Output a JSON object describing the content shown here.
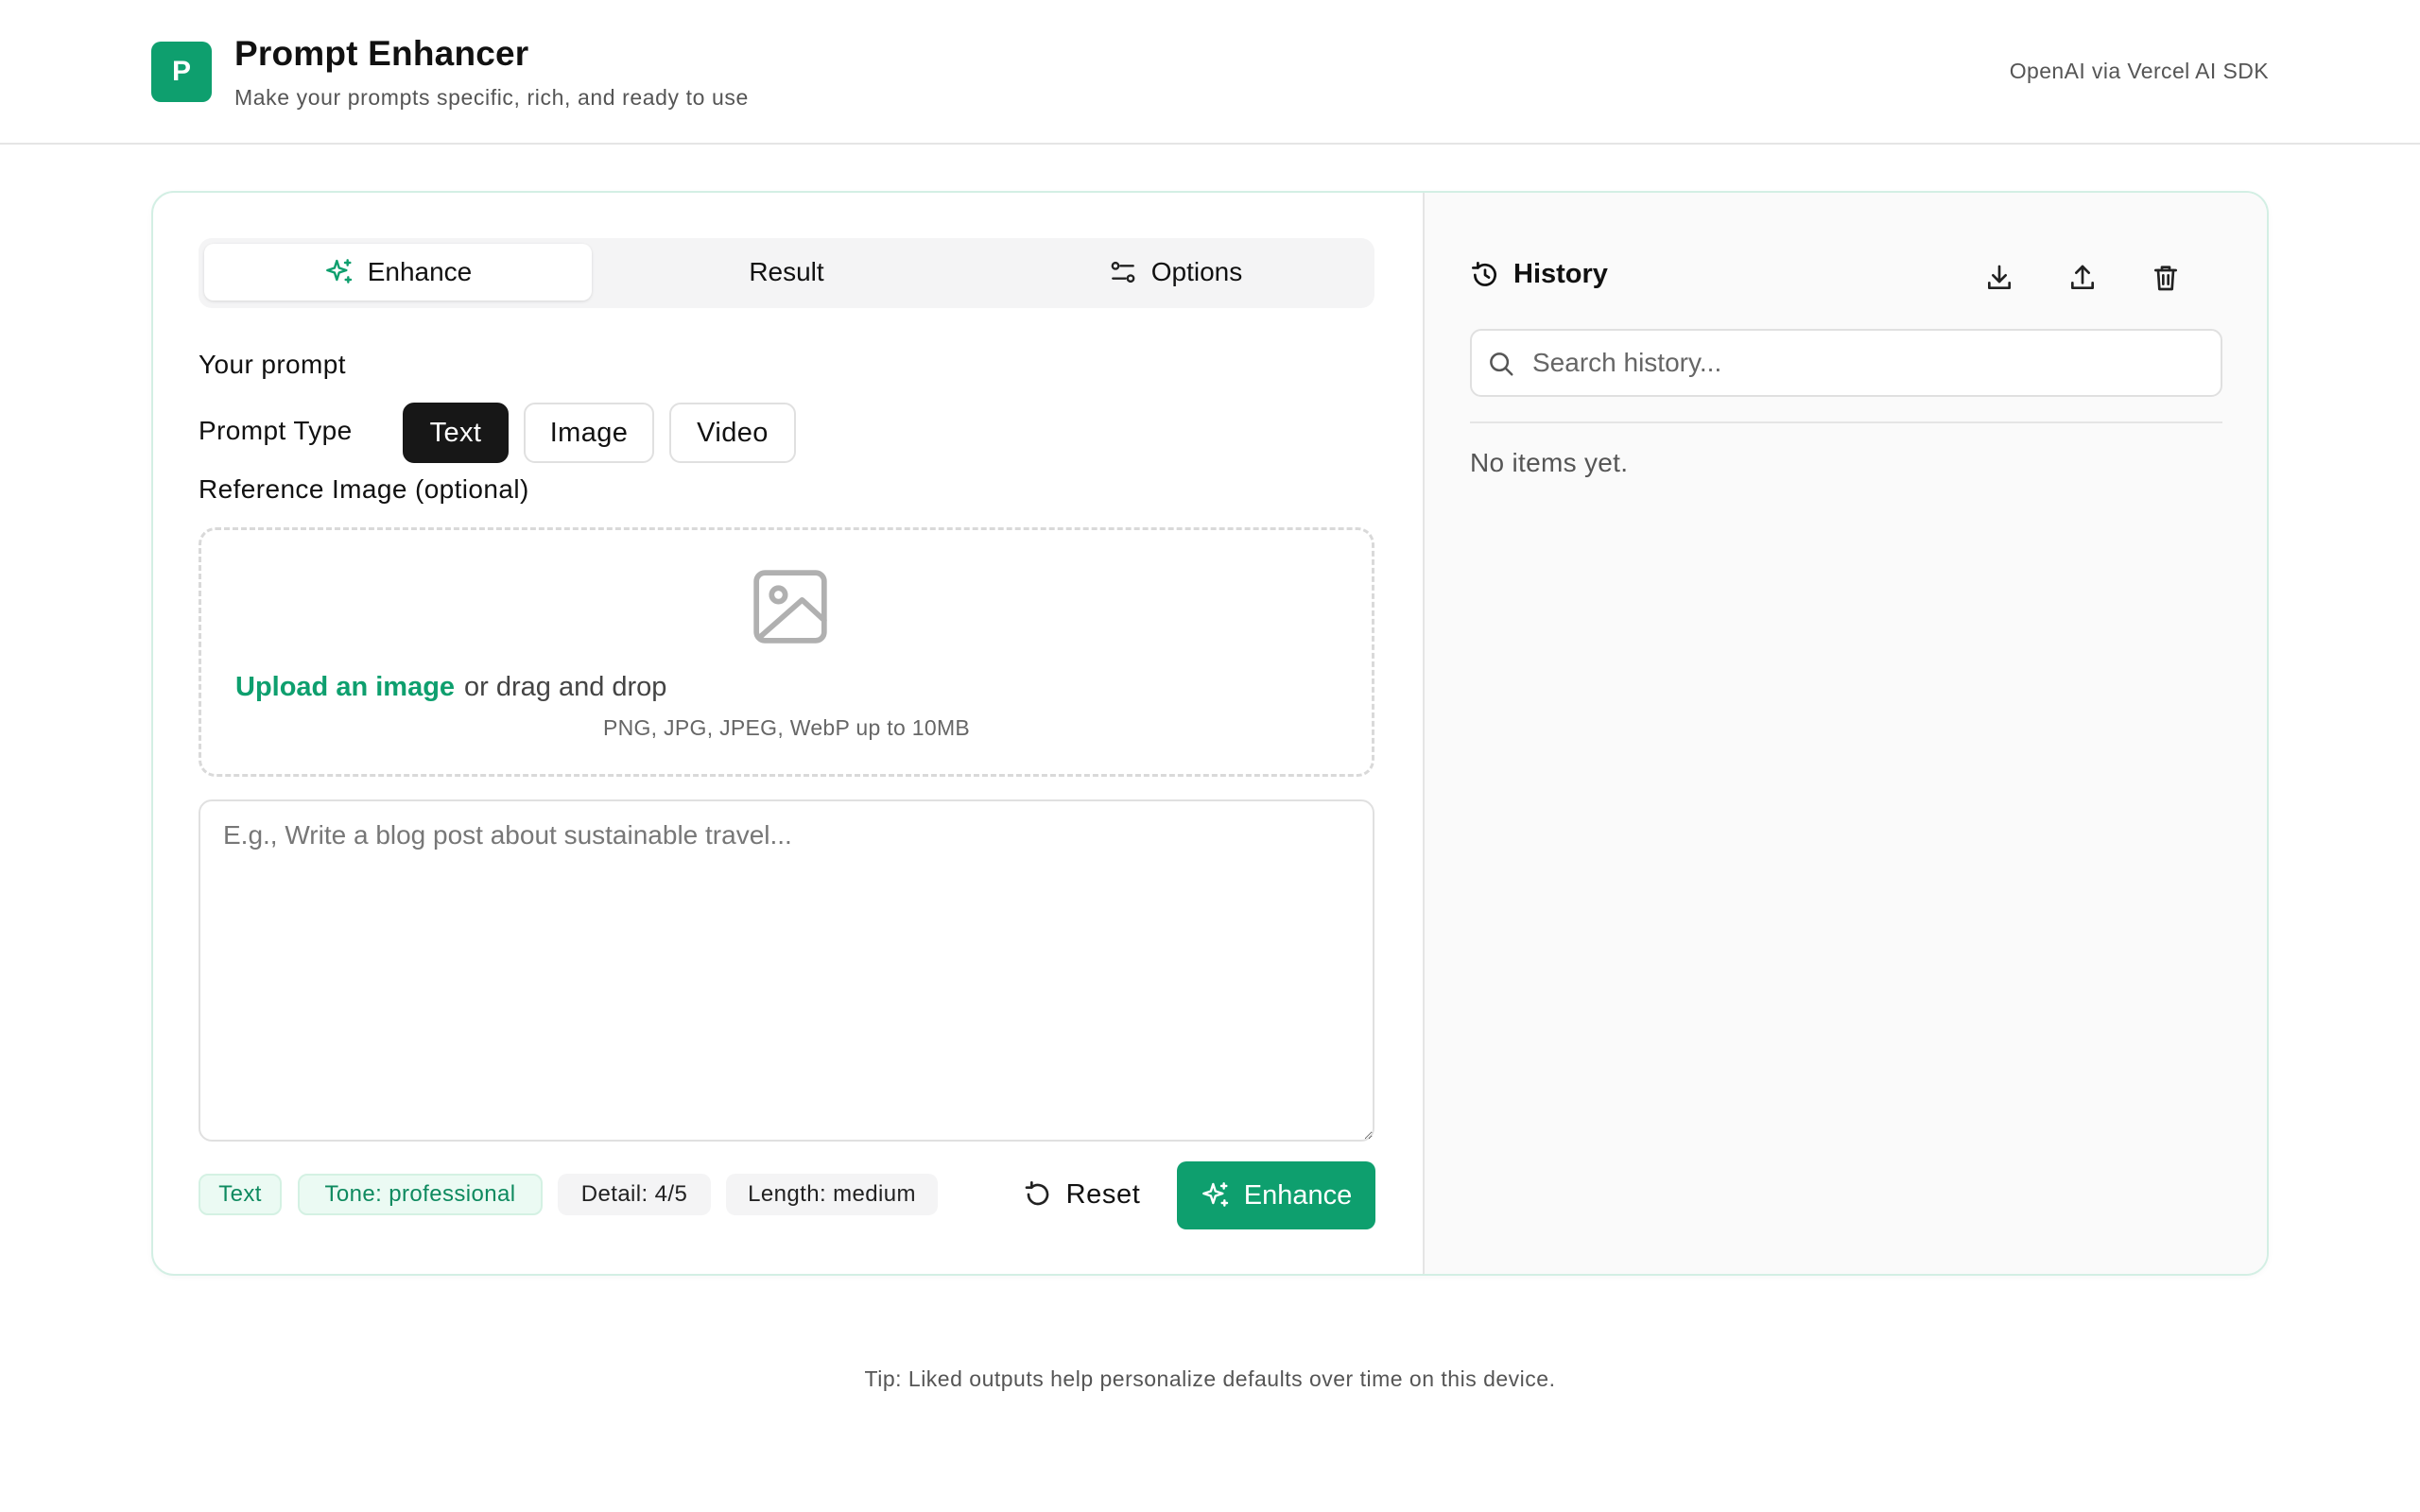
{
  "header": {
    "logo_letter": "P",
    "title": "Prompt Enhancer",
    "subtitle": "Make your prompts specific, rich, and ready to use",
    "provider": "OpenAI via Vercel AI SDK"
  },
  "tabs": [
    {
      "label": "Enhance",
      "icon": "sparkles-icon",
      "active": true
    },
    {
      "label": "Result",
      "active": false
    },
    {
      "label": "Options",
      "icon": "sliders-icon",
      "active": false
    }
  ],
  "form": {
    "section_label": "Your prompt",
    "prompt_type_label": "Prompt Type",
    "prompt_types": [
      {
        "label": "Text",
        "selected": true
      },
      {
        "label": "Image",
        "selected": false
      },
      {
        "label": "Video",
        "selected": false
      }
    ],
    "reference_label": "Reference Image (optional)",
    "upload_link": "Upload an image",
    "drag_text": "or drag and drop",
    "file_hint": "PNG, JPG, JPEG, WebP up to 10MB",
    "prompt_placeholder": "E.g., Write a blog post about sustainable travel...",
    "prompt_value": ""
  },
  "chips": [
    {
      "label": "Text",
      "style": "green"
    },
    {
      "label": "Tone: professional",
      "style": "green"
    },
    {
      "label": "Detail: 4/5",
      "style": "gray"
    },
    {
      "label": "Length: medium",
      "style": "gray"
    }
  ],
  "actions": {
    "reset_label": "Reset",
    "enhance_label": "Enhance"
  },
  "history": {
    "title": "History",
    "search_placeholder": "Search history...",
    "empty_text": "No items yet."
  },
  "footer": {
    "tip": "Tip: Liked outputs help personalize defaults over time on this device."
  },
  "colors": {
    "accent": "#0e9f6e",
    "dark": "#171717",
    "border": "#e0e0e0"
  }
}
